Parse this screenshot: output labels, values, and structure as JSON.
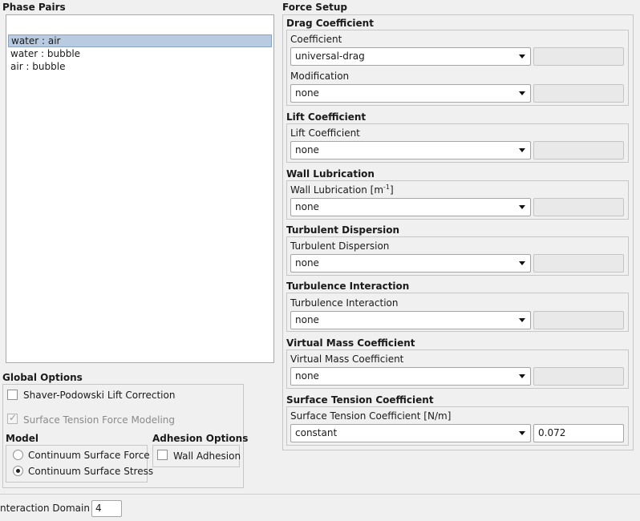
{
  "phase_pairs": {
    "title": "Phase Pairs",
    "items": [
      {
        "label": "water : air",
        "selected": true
      },
      {
        "label": "water : bubble",
        "selected": false
      },
      {
        "label": "air : bubble",
        "selected": false
      }
    ]
  },
  "global_options": {
    "title": "Global Options",
    "shaver_label": "Shaver-Podowski Lift Correction",
    "shaver_checked": false,
    "surface_tension_label": "Surface Tension Force Modeling",
    "surface_tension_checked": true,
    "model_title": "Model",
    "model_options": [
      "Continuum Surface Force",
      "Continuum Surface Stress"
    ],
    "model_selected": "Continuum Surface Stress",
    "adhesion_title": "Adhesion Options",
    "wall_adhesion_label": "Wall Adhesion",
    "wall_adhesion_checked": false
  },
  "interaction_domain": {
    "label": "nteraction Domain ID",
    "value": "4"
  },
  "force_setup": {
    "title": "Force Setup",
    "drag": {
      "title": "Drag Coefficient",
      "coef_label": "Coefficient",
      "coef_value": "universal-drag",
      "mod_label": "Modification",
      "mod_value": "none"
    },
    "lift": {
      "title": "Lift Coefficient",
      "label": "Lift Coefficient",
      "value": "none"
    },
    "wall_lubrication": {
      "title": "Wall Lubrication",
      "label_main": "Wall Lubrication [m",
      "label_sup": "-1",
      "label_end": "]",
      "value": "none"
    },
    "turbulent_dispersion": {
      "title": "Turbulent Dispersion",
      "label": "Turbulent Dispersion",
      "value": "none"
    },
    "turbulence_interaction": {
      "title": "Turbulence Interaction",
      "label": "Turbulence Interaction",
      "value": "none"
    },
    "virtual_mass": {
      "title": "Virtual Mass Coefficient",
      "label": "Virtual Mass Coefficient",
      "value": "none"
    },
    "surface_tension": {
      "title": "Surface Tension Coefficient",
      "label": "Surface Tension Coefficient [N/m]",
      "value": "constant",
      "constant_value": "0.072"
    }
  }
}
